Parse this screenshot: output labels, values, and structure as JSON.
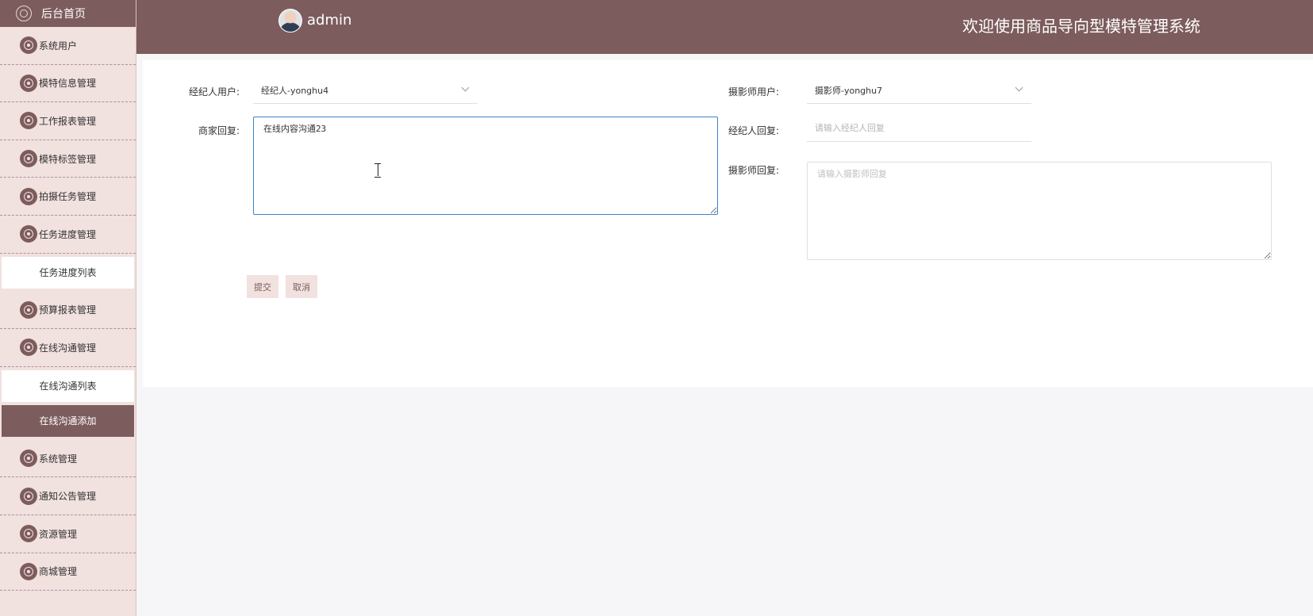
{
  "sidebar": {
    "home_label": "后台首页",
    "items": [
      {
        "type": "menu",
        "label": "系统用户"
      },
      {
        "type": "menu",
        "label": "模特信息管理"
      },
      {
        "type": "menu",
        "label": "工作报表管理"
      },
      {
        "type": "menu",
        "label": "模特标签管理"
      },
      {
        "type": "menu",
        "label": "拍摄任务管理"
      },
      {
        "type": "menu",
        "label": "任务进度管理"
      },
      {
        "type": "sub",
        "label": "任务进度列表"
      },
      {
        "type": "menu",
        "label": "预算报表管理"
      },
      {
        "type": "menu",
        "label": "在线沟通管理"
      },
      {
        "type": "sub",
        "label": "在线沟通列表"
      },
      {
        "type": "sub-active",
        "label": "在线沟通添加"
      },
      {
        "type": "menu",
        "label": "系统管理"
      },
      {
        "type": "menu",
        "label": "通知公告管理"
      },
      {
        "type": "menu",
        "label": "资源管理"
      },
      {
        "type": "menu",
        "label": "商城管理"
      }
    ]
  },
  "header": {
    "username": "admin",
    "site_title": "欢迎使用商品导向型模特管理系统"
  },
  "form": {
    "agent_user_label": "经纪人用户:",
    "agent_user_value": "经纪人-yonghu4",
    "photographer_user_label": "摄影师用户:",
    "photographer_user_value": "摄影师-yonghu7",
    "merchant_reply_label": "商家回复:",
    "merchant_reply_value": "在线内容沟通23",
    "agent_reply_label": "经纪人回复:",
    "agent_reply_placeholder": "请输入经纪人回复",
    "photographer_reply_label": "摄影师回复:",
    "photographer_reply_placeholder": "请输入摄影师回复",
    "submit_label": "提交",
    "cancel_label": "取消"
  },
  "colors": {
    "primary": "#7d5c5d",
    "sidebar_bg": "#f1e1df",
    "focus_border": "#3b83c9"
  }
}
